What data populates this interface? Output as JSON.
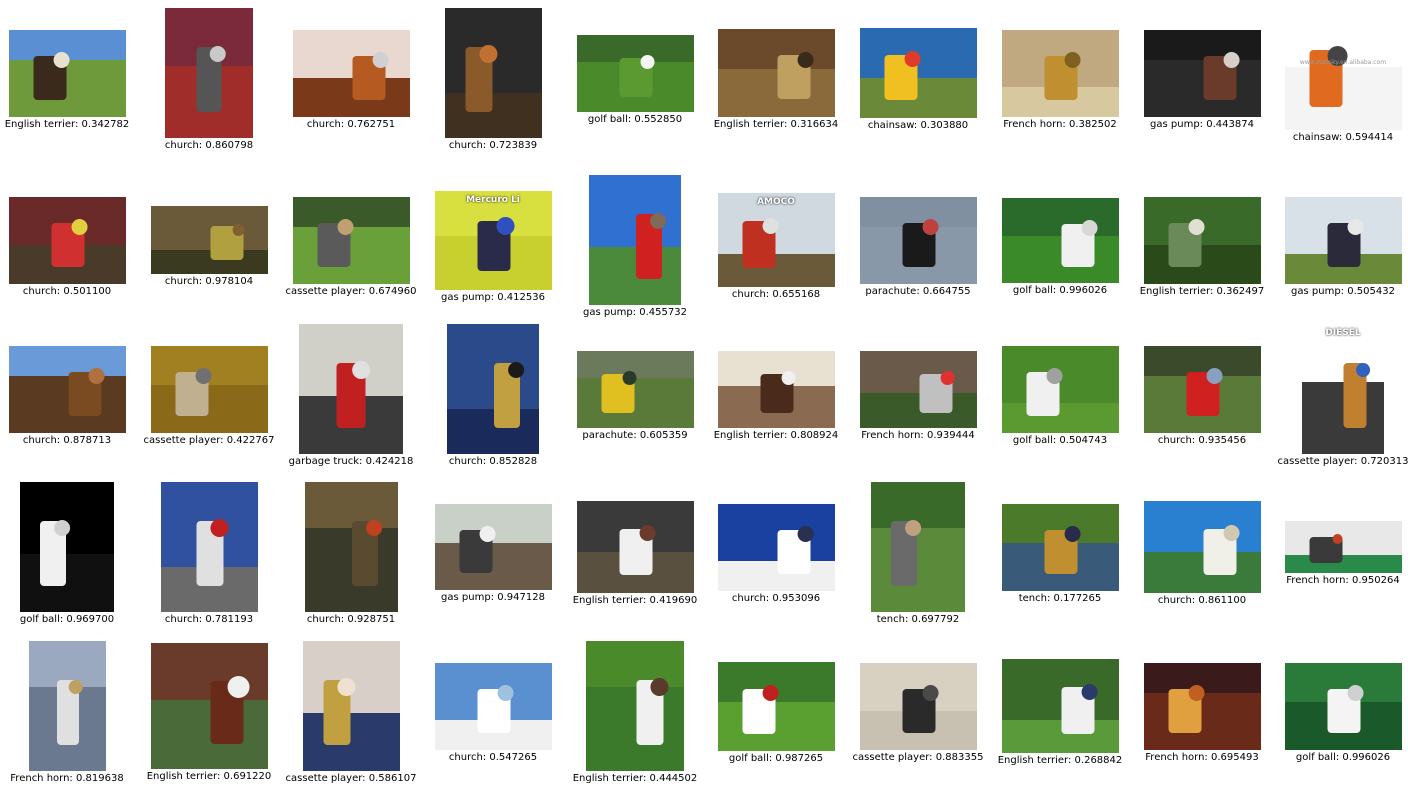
{
  "grid": {
    "rows": [
      [
        {
          "label": "English terrier: 0.342782",
          "icon": "dog-field-thumbnail-icon"
        },
        {
          "label": "church: 0.860798",
          "icon": "gas-pump-thumbnail-icon"
        },
        {
          "label": "church: 0.762751",
          "icon": "chainsaw-thumbnail-icon"
        },
        {
          "label": "church: 0.723839",
          "icon": "wooden-church-thumbnail-icon"
        },
        {
          "label": "golf ball: 0.552850",
          "icon": "golf-ball-grass-thumbnail-icon"
        },
        {
          "label": "English terrier: 0.316634",
          "icon": "church-interior-thumbnail-icon"
        },
        {
          "label": "chainsaw: 0.303880",
          "icon": "parachute-diagram-thumbnail-icon"
        },
        {
          "label": "French horn: 0.382502",
          "icon": "french-horn-thumbnail-icon"
        },
        {
          "label": "gas pump: 0.443874",
          "icon": "dog-indoor-thumbnail-icon"
        },
        {
          "label": "chainsaw: 0.594414",
          "icon": "chainsaw-product-thumbnail-icon",
          "watermark": "www.ztopsky.en.alibaba.com"
        }
      ],
      [
        {
          "label": "church: 0.501100",
          "icon": "gas-station-thumbnail-icon"
        },
        {
          "label": "church: 0.978104",
          "icon": "tench-fish-thumbnail-icon"
        },
        {
          "label": "cassette player: 0.674960",
          "icon": "man-holding-fish-thumbnail-icon"
        },
        {
          "label": "gas pump: 0.412536",
          "icon": "cassette-player-thumbnail-icon",
          "sign_text": "Mercuro Li"
        },
        {
          "label": "gas pump: 0.455732",
          "icon": "church-red-tree-thumbnail-icon"
        },
        {
          "label": "church: 0.655168",
          "icon": "amoco-pump-thumbnail-icon",
          "sign_text": "AMOCO"
        },
        {
          "label": "parachute: 0.664755",
          "icon": "skydiver-sky-thumbnail-icon"
        },
        {
          "label": "golf ball: 0.996026",
          "icon": "golf-ball-closeup-thumbnail-icon"
        },
        {
          "label": "English terrier: 0.362497",
          "icon": "man-in-garden-thumbnail-icon"
        },
        {
          "label": "gas pump: 0.505432",
          "icon": "dump-truck-thumbnail-icon"
        }
      ],
      [
        {
          "label": "church: 0.878713",
          "icon": "stave-church-roof-thumbnail-icon"
        },
        {
          "label": "cassette player: 0.422767",
          "icon": "walkman-thumbnail-icon"
        },
        {
          "label": "garbage truck: 0.424218",
          "icon": "vintage-gas-pump-thumbnail-icon"
        },
        {
          "label": "church: 0.852828",
          "icon": "girl-french-horn-thumbnail-icon"
        },
        {
          "label": "parachute: 0.605359",
          "icon": "parachute-landing-thumbnail-icon"
        },
        {
          "label": "English terrier: 0.808924",
          "icon": "springer-spaniel-thumbnail-icon"
        },
        {
          "label": "French horn: 0.939444",
          "icon": "group-photo-thumbnail-icon"
        },
        {
          "label": "golf ball: 0.504743",
          "icon": "golf-putt-thumbnail-icon"
        },
        {
          "label": "church: 0.935456",
          "icon": "garbage-truck-thumbnail-icon"
        },
        {
          "label": "cassette player: 0.720313",
          "icon": "diesel-pump-thumbnail-icon",
          "sign_text": "DIESEL"
        }
      ],
      [
        {
          "label": "golf ball: 0.969700",
          "icon": "nike-golf-balls-thumbnail-icon"
        },
        {
          "label": "church: 0.781193",
          "icon": "fuel-dispenser-thumbnail-icon"
        },
        {
          "label": "church: 0.928751",
          "icon": "old-pump-interior-thumbnail-icon"
        },
        {
          "label": "gas pump: 0.947128",
          "icon": "room-with-tv-thumbnail-icon"
        },
        {
          "label": "English terrier: 0.419690",
          "icon": "dog-show-thumbnail-icon"
        },
        {
          "label": "church: 0.953096",
          "icon": "white-church-steeple-thumbnail-icon"
        },
        {
          "label": "tench: 0.697792",
          "icon": "man-with-chainsaw-thumbnail-icon"
        },
        {
          "label": "tench: 0.177265",
          "icon": "man-with-tench-thumbnail-icon"
        },
        {
          "label": "church: 0.861100",
          "icon": "white-cathedral-thumbnail-icon"
        },
        {
          "label": "French horn: 0.950264",
          "icon": "fuel-nozzles-thumbnail-icon"
        }
      ],
      [
        {
          "label": "French horn: 0.819638",
          "icon": "golf-trophy-thumbnail-icon"
        },
        {
          "label": "English terrier: 0.691220",
          "icon": "spaniel-sitting-thumbnail-icon"
        },
        {
          "label": "cassette player: 0.586107",
          "icon": "man-french-horn-thumbnail-icon"
        },
        {
          "label": "church: 0.547265",
          "icon": "sky-clouds-thumbnail-icon"
        },
        {
          "label": "English terrier: 0.444502",
          "icon": "dog-on-grass-thumbnail-icon"
        },
        {
          "label": "golf ball: 0.987265",
          "icon": "church-on-green-thumbnail-icon"
        },
        {
          "label": "cassette player: 0.883355",
          "icon": "electronics-devices-thumbnail-icon"
        },
        {
          "label": "English terrier: 0.268842",
          "icon": "boy-with-fish-thumbnail-icon"
        },
        {
          "label": "French horn: 0.695493",
          "icon": "organ-interior-thumbnail-icon"
        },
        {
          "label": "golf ball: 0.996026",
          "icon": "golf-ball-macro-thumbnail-icon"
        }
      ]
    ]
  }
}
